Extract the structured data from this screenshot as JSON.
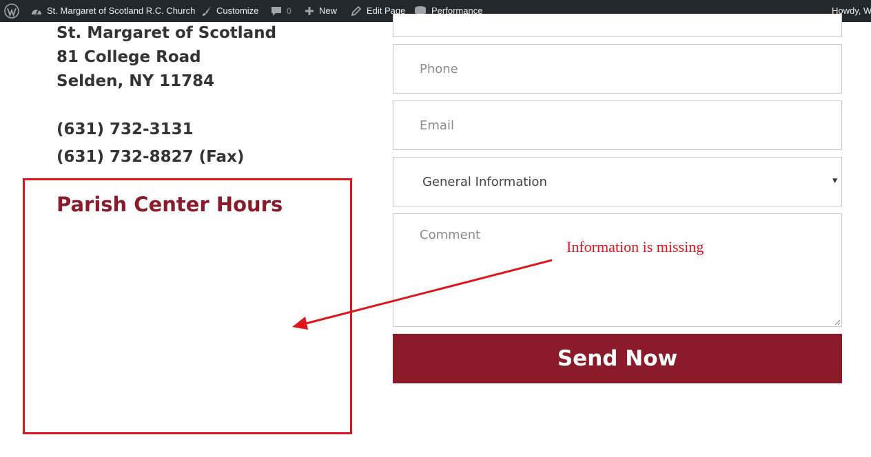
{
  "adminbar": {
    "site_name": "St. Margaret of Scotland R.C. Church",
    "customize": "Customize",
    "comments_count": "0",
    "new": "New",
    "edit_page": "Edit Page",
    "performance": "Performance",
    "howdy": "Howdy, W"
  },
  "contact": {
    "address_lines": [
      "St. Margaret of Scotland",
      "81 College Road",
      "Selden, NY 11784"
    ],
    "phone": "(631) 732-3131",
    "fax": "(631) 732-8827 (Fax)"
  },
  "hours": {
    "title": "Parish Center Hours"
  },
  "form": {
    "phone_placeholder": "Phone",
    "email_placeholder": "Email",
    "subject_selected": "General Information",
    "comment_placeholder": "Comment",
    "submit_label": "Send Now"
  },
  "annotation": {
    "text": "Information is missing",
    "color": "#e0141b"
  },
  "colors": {
    "brand": "#8b1a2b",
    "adminbar_bg": "#23282d"
  },
  "icons": [
    "wordpress-icon",
    "dashboard-icon",
    "paintbrush-icon",
    "comment-bubble-icon",
    "plus-icon",
    "pencil-icon",
    "performance-icon"
  ]
}
